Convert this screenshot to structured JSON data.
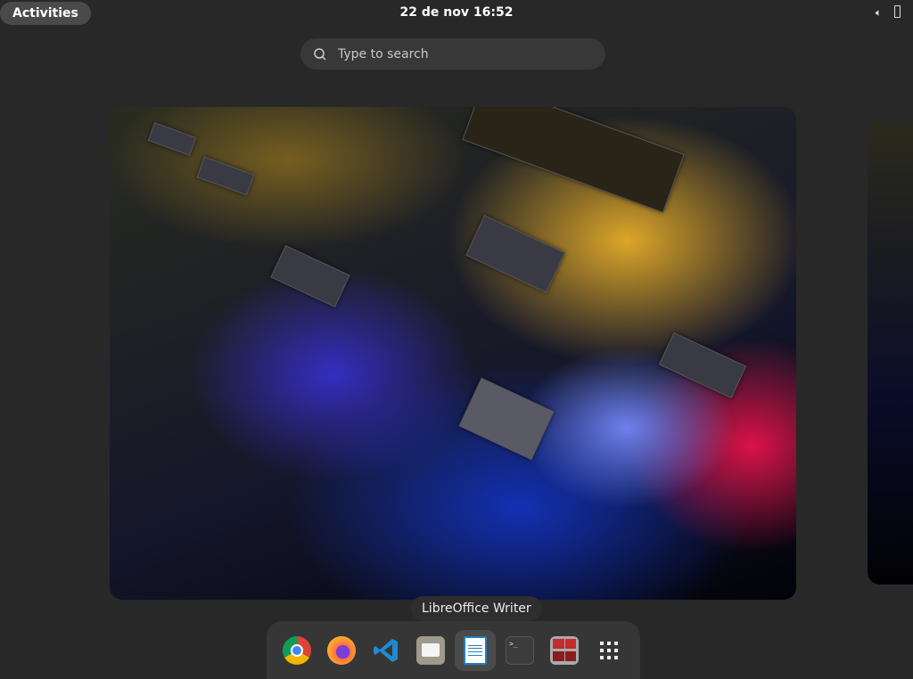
{
  "topbar": {
    "activities_label": "Activities",
    "clock": "22 de nov  16:52",
    "icons": [
      "volume-icon",
      "battery-icon"
    ]
  },
  "search": {
    "placeholder": "Type to search",
    "value": ""
  },
  "tooltip": "LibreOffice Writer",
  "dock": {
    "apps": [
      {
        "name": "Google Chrome",
        "icon": "chrome-icon"
      },
      {
        "name": "Firefox",
        "icon": "firefox-icon"
      },
      {
        "name": "Visual Studio Code",
        "icon": "vscode-icon"
      },
      {
        "name": "Files",
        "icon": "files-icon"
      },
      {
        "name": "LibreOffice Writer",
        "icon": "writer-icon",
        "active": true
      },
      {
        "name": "Terminal",
        "icon": "terminal-icon"
      },
      {
        "name": "Terminator",
        "icon": "terminator-icon"
      },
      {
        "name": "Show Applications",
        "icon": "app-grid-icon"
      }
    ]
  }
}
